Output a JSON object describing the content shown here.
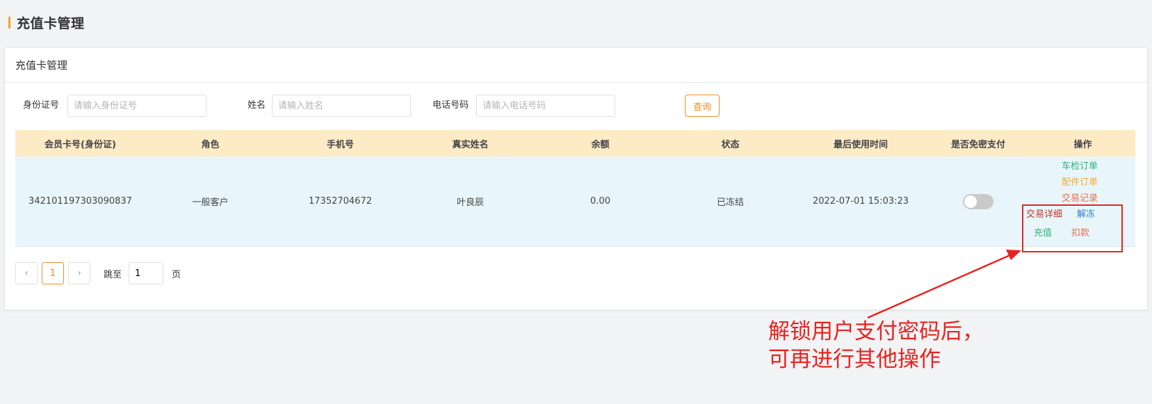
{
  "page": {
    "title": "充值卡管理"
  },
  "panel": {
    "title": "充值卡管理"
  },
  "search": {
    "id_label": "身份证号",
    "id_placeholder": "请输入身份证号",
    "name_label": "姓名",
    "name_placeholder": "请输入姓名",
    "phone_label": "电话号码",
    "phone_placeholder": "请输入电话号码",
    "query_button": "查询"
  },
  "table": {
    "headers": [
      "会员卡号(身份证)",
      "角色",
      "手机号",
      "真实姓名",
      "余额",
      "状态",
      "最后使用时间",
      "是否免密支付",
      "操作"
    ],
    "rows": [
      {
        "card_no": "342101197303090837",
        "role": "一般客户",
        "phone": "17352704672",
        "name": "叶良辰",
        "balance": "0.00",
        "status": "已冻结",
        "last_used": "2022-07-01 15:03:23",
        "password_free": false,
        "ops": {
          "inspection_orders": "车检订单",
          "parts_orders": "配件订单",
          "transaction_records": "交易记录",
          "transaction_details": "交易详细",
          "unfreeze": "解冻",
          "recharge": "充值",
          "deduct": "扣款"
        }
      }
    ]
  },
  "pagination": {
    "prev": "‹",
    "current": "1",
    "next": "›",
    "jump_label": "跳至",
    "jump_value": "1",
    "page_suffix": "页"
  },
  "annotation": {
    "text": "解锁用户支付密码后，\n可再进行其他操作"
  },
  "colors": {
    "accent": "#f5a623",
    "query_btn": "#e8902a",
    "header_bg": "#fdebc6",
    "row_bg": "#e8f6fb",
    "op_green": "#2bb673",
    "op_orange": "#f0ad2e",
    "op_red": "#e8704a",
    "op_darkred": "#c0392b",
    "op_blue": "#2d7fd3",
    "annotation": "#e8231f"
  }
}
